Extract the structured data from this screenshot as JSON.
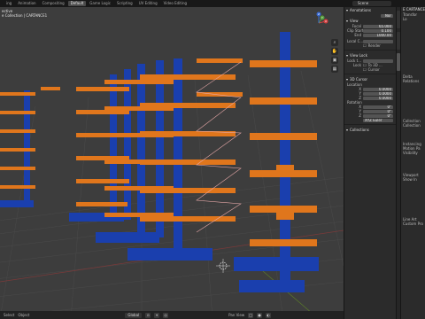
{
  "top_tabs": [
    "ing",
    "Animation",
    "Compositing",
    "Default",
    "Game Logic",
    "Scripting",
    "UV Editing",
    "Video Editing"
  ],
  "active_tab": "Default",
  "scene_name": "Scene",
  "viewport": {
    "info_lines": [
      "ective",
      "e Collection | CARTANCE1"
    ]
  },
  "gizmo": {
    "x": "X",
    "y": "Y",
    "z": "Z"
  },
  "sidebar": {
    "annotations": "Annotations",
    "annotations_value": "Nor",
    "view": "View",
    "focal_label": "Focal",
    "focal_value": "65.000",
    "clip_start_label": "Clip Start",
    "clip_start_value": "0.100",
    "end_label": "End",
    "end_value": "1000.00",
    "local_cam_label": "Local C...",
    "render_label": "Render",
    "view_lock": "View Lock",
    "lock_to_label": "Lock t...",
    "lock_label": "Lock",
    "lock_value": "To 3D ...",
    "cursor_label": "Cursor",
    "cursor_3d": "3D Cursor",
    "location_label": "Location",
    "loc_x": "0.0000",
    "loc_y": "0.0000",
    "loc_z": "0.0000",
    "rotation_label": "Rotation",
    "rot_x": "0°",
    "rot_y": "0°",
    "rot_z": "0°",
    "xyz_euler": "XYZ Euler",
    "collections": "Collections"
  },
  "props": {
    "lines": [
      "E CARTANCE",
      "Transfor",
      "Lo",
      "Delta",
      "Relations",
      "Collection",
      "Collection",
      "Instancing",
      "Motion Pa",
      "Visibility",
      "Viewport",
      "Show In",
      "Line Art",
      "Custom Pro"
    ]
  },
  "status": {
    "select": "Select",
    "view_label": "Global",
    "pan": "Pan View",
    "object": "Object"
  }
}
